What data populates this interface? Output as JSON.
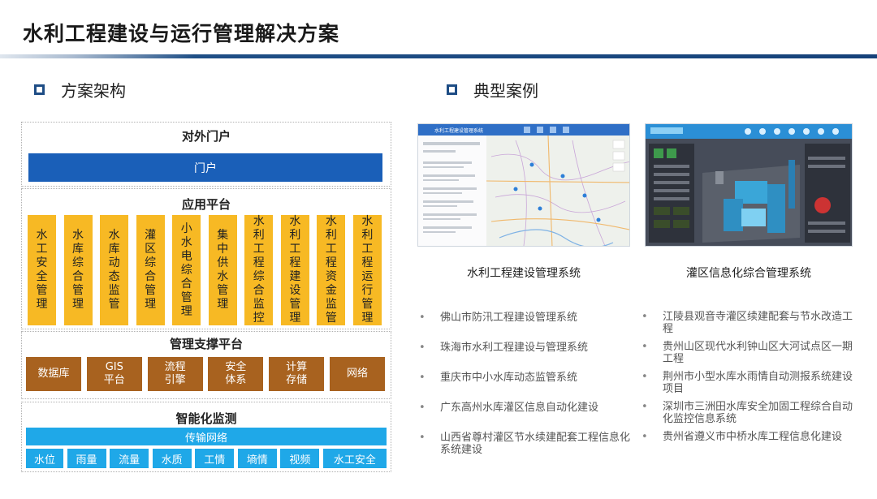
{
  "title": "水利工程建设与运行管理解决方案",
  "sections": {
    "left_heading": "方案架构",
    "right_heading": "典型案例"
  },
  "architecture": {
    "portal_title": "对外门户",
    "portal_bar": "门户",
    "app_title": "应用平台",
    "apps": [
      "水工安全管理",
      "水库综合管理",
      "水库动态监管",
      "灌区综合管理",
      "小水电综合管理",
      "集中供水管理",
      "水利工程综合监控",
      "水利工程建设管理",
      "水利工程资金监管",
      "水利工程运行管理"
    ],
    "support_title": "管理支撑平台",
    "support": [
      "数据库",
      "GIS\n平台",
      "流程\n引擎",
      "安全\n体系",
      "计算\n存储",
      "网络"
    ],
    "monitor_title": "智能化监测",
    "network_bar": "传输网络",
    "monitors": [
      "水位",
      "雨量",
      "流量",
      "水质",
      "工情",
      "墒情",
      "视频",
      "水工安全"
    ]
  },
  "screenshots": {
    "shot1_header": "水利工程建设管理系统",
    "shot1_caption": "水利工程建设管理系统",
    "shot2_caption": "灌区信息化综合管理系统"
  },
  "cases_left": [
    "佛山市防汛工程建设管理系统",
    "珠海市水利工程建设与管理系统",
    "重庆市中小水库动态监管系统",
    "广东高州水库灌区信息自动化建设",
    "山西省尊村灌区节水续建配套工程信息化系统建设"
  ],
  "cases_right": [
    "江陵县观音寺灌区续建配套与节水改造工程",
    "贵州山区现代水利钟山区大河试点区一期工程",
    "荆州市小型水库水雨情自动测报系统建设项目",
    "深圳市三洲田水库安全加固工程综合自动化监控信息系统",
    "贵州省遵义市中桥水库工程信息化建设"
  ],
  "colors": {
    "portal": "#1a5fb8",
    "app": "#f7b924",
    "support": "#a8621f",
    "monitor": "#1fa8e8",
    "accent": "#1e4d85"
  }
}
